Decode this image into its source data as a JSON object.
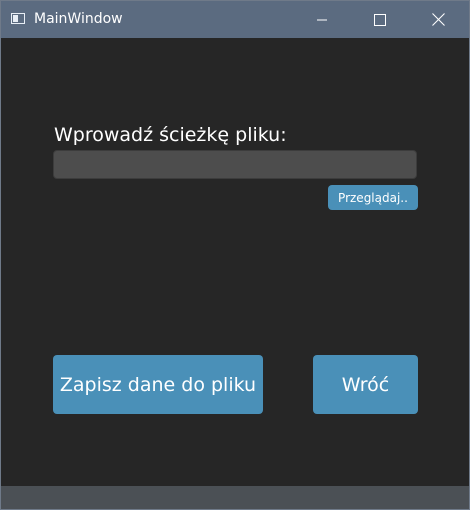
{
  "window": {
    "title": "MainWindow"
  },
  "icons": {
    "app": "app-window-icon",
    "minimize": "minimize-icon",
    "maximize": "maximize-icon",
    "close": "close-icon"
  },
  "main": {
    "path_label": "Wprowadź ścieżkę pliku:",
    "path_value": "",
    "path_placeholder": "",
    "browse_label": "Przeglądaj..",
    "save_label": "Zapisz dane do pliku",
    "back_label": "Wróć"
  },
  "colors": {
    "background": "#262626",
    "titlebar": "#5b6b80",
    "accent": "#4a90b8",
    "input": "#4d4d4d",
    "statusbar": "#4b5055"
  }
}
